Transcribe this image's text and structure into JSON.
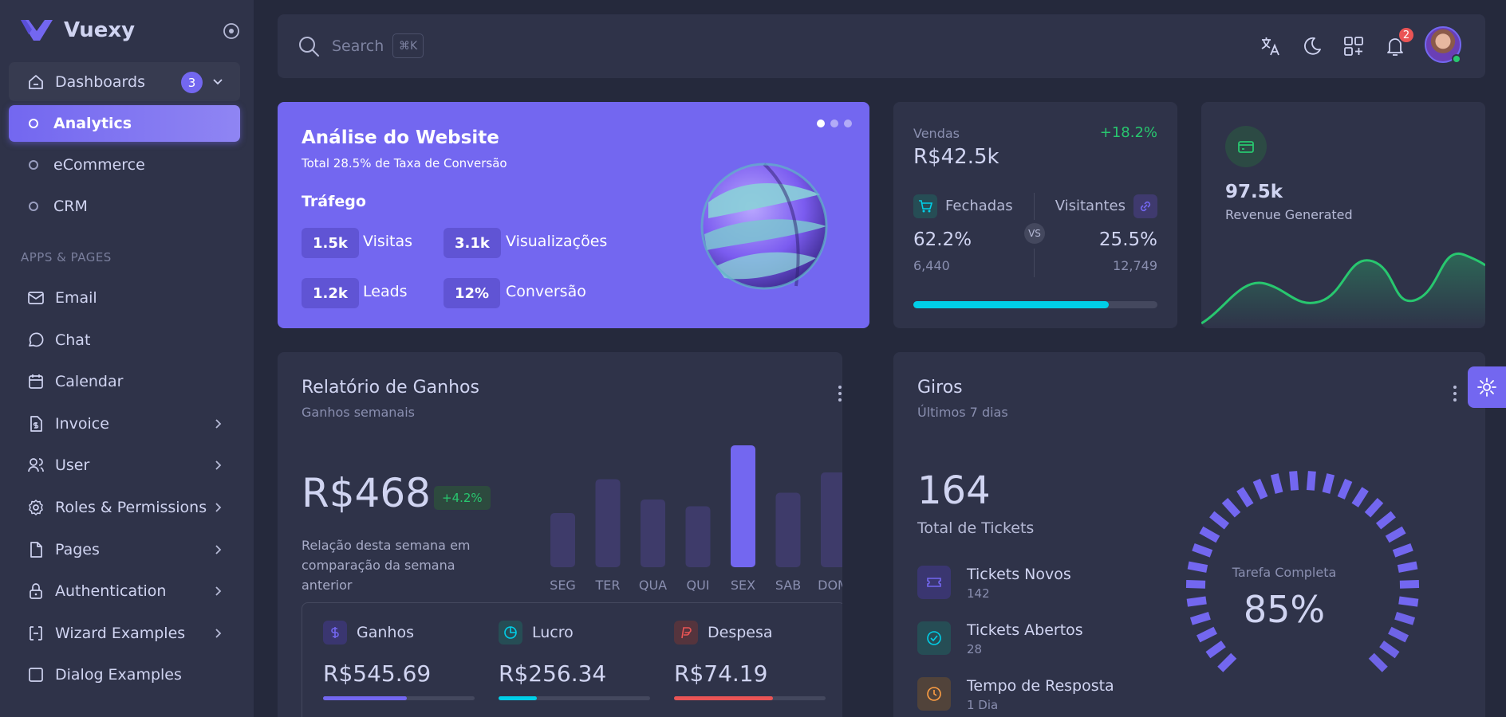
{
  "brand": {
    "name": "Vuexy"
  },
  "sidebar": {
    "dashboards_label": "Dashboards",
    "dashboards_badge": "3",
    "sub_items": [
      "Analytics",
      "eCommerce",
      "CRM"
    ],
    "section_header": "APPS & PAGES",
    "items": [
      {
        "label": "Email",
        "icon": "mail-icon",
        "chevron": false
      },
      {
        "label": "Chat",
        "icon": "chat-icon",
        "chevron": false
      },
      {
        "label": "Calendar",
        "icon": "calendar-icon",
        "chevron": false
      },
      {
        "label": "Invoice",
        "icon": "invoice-icon",
        "chevron": true
      },
      {
        "label": "User",
        "icon": "users-icon",
        "chevron": true
      },
      {
        "label": "Roles & Permissions",
        "icon": "settings-icon",
        "chevron": true
      },
      {
        "label": "Pages",
        "icon": "file-icon",
        "chevron": true
      },
      {
        "label": "Authentication",
        "icon": "lock-icon",
        "chevron": true
      },
      {
        "label": "Wizard Examples",
        "icon": "wizard-icon",
        "chevron": true
      },
      {
        "label": "Dialog Examples",
        "icon": "square-icon",
        "chevron": false
      }
    ]
  },
  "topbar": {
    "search_placeholder": "Search",
    "search_shortcut": "⌘K",
    "notification_count": "2"
  },
  "website_analytics": {
    "title": "Análise do Website",
    "subtitle": "Total 28.5% de Taxa de Conversão",
    "section": "Tráfego",
    "stats": [
      {
        "value": "1.5k",
        "label": "Visitas"
      },
      {
        "value": "3.1k",
        "label": "Visualizações"
      },
      {
        "value": "1.2k",
        "label": "Leads"
      },
      {
        "value": "12%",
        "label": "Conversão"
      }
    ]
  },
  "sales": {
    "label": "Vendas",
    "change": "+18.2%",
    "value": "R$42.5k",
    "left_label": "Fechadas",
    "left_pct": "62.2%",
    "left_count": "6,440",
    "vs": "VS",
    "right_label": "Visitantes",
    "right_pct": "25.5%",
    "right_count": "12,749",
    "progress": 0.8
  },
  "revenue": {
    "value": "97.5k",
    "label": "Revenue Generated",
    "accent": "#28c76f"
  },
  "earnings": {
    "title": "Relatório de Ganhos",
    "subtitle": "Ganhos semanais",
    "value": "R$468",
    "change": "+4.2%",
    "description": "Relação desta semana em comparação da semana anterior",
    "metrics": [
      {
        "name": "Ganhos",
        "value": "R$545.69",
        "progress": 0.55,
        "color": "#7367f0"
      },
      {
        "name": "Lucro",
        "value": "R$256.34",
        "progress": 0.25,
        "color": "#00cfe8"
      },
      {
        "name": "Despesa",
        "value": "R$74.19",
        "progress": 0.65,
        "color": "#ea5455"
      }
    ]
  },
  "chart_data": {
    "type": "bar",
    "categories": [
      "SEG",
      "TER",
      "QUA",
      "QUI",
      "SEX",
      "SAB",
      "DOM"
    ],
    "values": [
      40,
      65,
      50,
      45,
      90,
      55,
      70
    ],
    "highlight_index": 4
  },
  "giros": {
    "title": "Giros",
    "subtitle": "Últimos 7 dias",
    "total": "164",
    "total_label": "Total de Tickets",
    "rows": [
      {
        "name": "Tickets Novos",
        "value": "142",
        "color": "#7367f0"
      },
      {
        "name": "Tickets Abertos",
        "value": "28",
        "color": "#00cfe8"
      },
      {
        "name": "Tempo de Resposta",
        "value": "1 Dia",
        "color": "#ff9f43"
      }
    ],
    "gauge_label": "Tarefa Completa",
    "gauge_value": "85%",
    "gauge_fraction": 0.85
  }
}
